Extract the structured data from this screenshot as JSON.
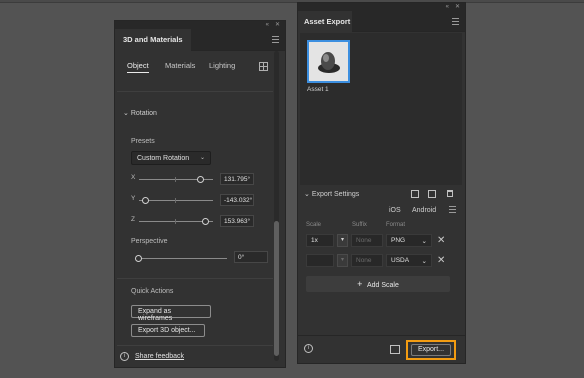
{
  "panel_3d": {
    "title": "3D and Materials",
    "tabs": [
      "Object",
      "Materials",
      "Lighting"
    ],
    "active_tab": "Object",
    "rotation_section": "Rotation",
    "presets_label": "Presets",
    "presets_value": "Custom Rotation",
    "x_label": "X",
    "x_value": "131.795°",
    "y_label": "Y",
    "y_value": "-143.032°",
    "z_label": "Z",
    "z_value": "153.963°",
    "perspective_label": "Perspective",
    "perspective_value": "0°",
    "quick_actions_label": "Quick Actions",
    "expand_wireframes": "Expand as wireframes",
    "export_3d": "Export 3D object...",
    "share_feedback": "Share feedback"
  },
  "panel_asset": {
    "title": "Asset Export",
    "asset_name": "Asset 1",
    "export_settings": "Export Settings",
    "platform_ios": "iOS",
    "platform_android": "Android",
    "col_scale": "Scale",
    "col_suffix": "Suffix",
    "col_format": "Format",
    "row1": {
      "scale": "1x",
      "suffix": "None",
      "format": "PNG"
    },
    "row2": {
      "scale": "",
      "suffix": "None",
      "format": "USDA"
    },
    "add_scale": "Add Scale",
    "export_button": "Export..."
  }
}
